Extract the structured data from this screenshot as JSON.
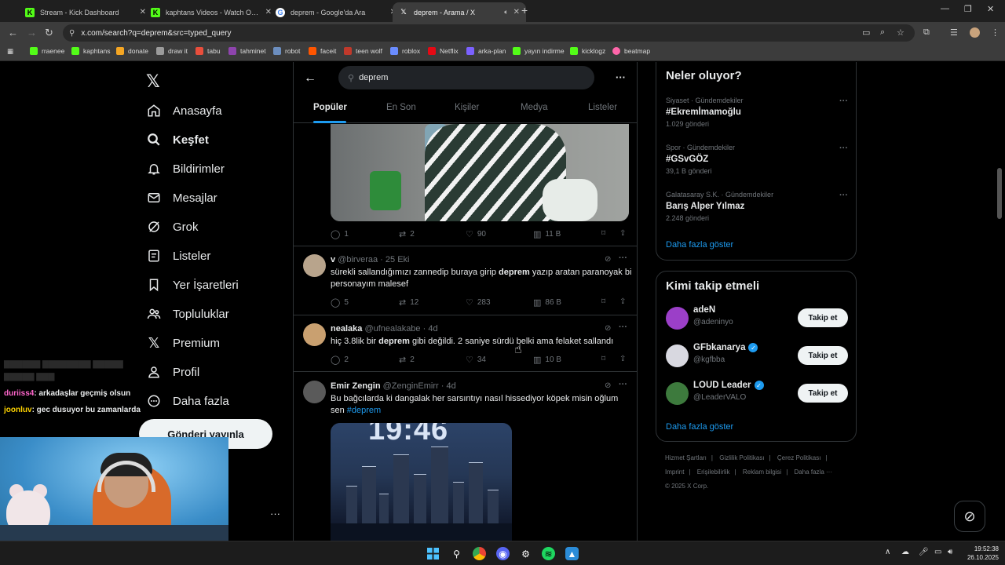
{
  "browser": {
    "tabs": [
      {
        "title": "Stream - Kick Dashboard",
        "icon": "kick-icon",
        "active": false
      },
      {
        "title": "kaphtans Videos - Watch On-D",
        "icon": "kick-icon",
        "active": false
      },
      {
        "title": "deprem - Google'da Ara",
        "icon": "google-icon",
        "active": false
      },
      {
        "title": "deprem - Arama / X",
        "icon": "x-icon",
        "active": true
      }
    ],
    "url": "x.com/search?q=deprem&src=typed_query",
    "bookmarks": [
      {
        "label": "rraenee",
        "color": "#53fc18"
      },
      {
        "label": "kaphtans",
        "color": "#53fc18"
      },
      {
        "label": "donate",
        "color": "#f5a623"
      },
      {
        "label": "draw it",
        "color": "#9b9b9b"
      },
      {
        "label": "tabu",
        "color": "#e94e3c"
      },
      {
        "label": "tahminet",
        "color": "#8e44ad"
      },
      {
        "label": "robot",
        "color": "#6c8ebf"
      },
      {
        "label": "faceit",
        "color": "#ff5500"
      },
      {
        "label": "teen wolf",
        "color": "#c0392b"
      },
      {
        "label": "roblox",
        "color": "#6a8cff"
      },
      {
        "label": "Netflix",
        "color": "#e50914"
      },
      {
        "label": "arka-plan",
        "color": "#7b61ff"
      },
      {
        "label": "yayın indirme",
        "color": "#53fc18"
      },
      {
        "label": "kicklogz",
        "color": "#53fc18"
      },
      {
        "label": "beatmap",
        "color": "#ff66aa"
      }
    ]
  },
  "nav": {
    "logo": "𝕏",
    "items": [
      {
        "label": "Anasayfa",
        "icon": "home-icon"
      },
      {
        "label": "Keşfet",
        "icon": "search-icon"
      },
      {
        "label": "Bildirimler",
        "icon": "bell-icon"
      },
      {
        "label": "Mesajlar",
        "icon": "mail-icon"
      },
      {
        "label": "Grok",
        "icon": "grok-icon"
      },
      {
        "label": "Listeler",
        "icon": "list-icon"
      },
      {
        "label": "Yer İşaretleri",
        "icon": "bookmark-icon"
      },
      {
        "label": "Topluluklar",
        "icon": "people-icon"
      },
      {
        "label": "Premium",
        "icon": "x-premium-icon"
      },
      {
        "label": "Profil",
        "icon": "profile-icon"
      },
      {
        "label": "Daha fazla",
        "icon": "more-icon"
      }
    ],
    "post_button": "Gönderi yayınla"
  },
  "chat": {
    "lines": [
      {
        "user": "duriiss4",
        "text": ": arkadaşlar geçmiş olsun"
      },
      {
        "user": "joonluv",
        "text": ": gec dusuyor bu zamanlarda"
      }
    ]
  },
  "search": {
    "query": "deprem",
    "tabs": [
      "Popüler",
      "En Son",
      "Kişiler",
      "Medya",
      "Listeler"
    ],
    "active_tab": "Popüler"
  },
  "top_tweet_actions": {
    "reply": "1",
    "retweet": "2",
    "like": "90",
    "views": "11 B"
  },
  "tweets": [
    {
      "name": "v",
      "handle": "@birveraa",
      "date": "25 Eki",
      "text_pre": "sürekli sallandığımızı zannedip buraya girip ",
      "text_bold": "deprem",
      "text_post": " yazıp aratan paranoyak bi personayım malesef",
      "reply": "5",
      "retweet": "12",
      "like": "283",
      "views": "86 B",
      "avatar_color": "#b8a48c"
    },
    {
      "name": "nealaka",
      "handle": "@ufnealakabe",
      "date": "4d",
      "text_pre": "hiç 3.8lik bir ",
      "text_bold": "deprem",
      "text_post": " gibi değildi. 2 saniye sürdü belki ama felaket sallandı",
      "reply": "2",
      "retweet": "2",
      "like": "34",
      "views": "10 B",
      "avatar_color": "#c9a070"
    },
    {
      "name": "Emir Zengin",
      "handle": "@ZenginEmirr",
      "date": "4d",
      "text_pre": "Bu bağcılarda ki dangalak her sarsıntıyı nasıl hissediyor köpek misin oğlum sen ",
      "hashtag": "#deprem",
      "avatar_color": "#5a5a5a",
      "image_time": "19:46"
    }
  ],
  "trends": {
    "title": "Neler oluyor?",
    "items": [
      {
        "meta": "Siyaset · Gündemdekiler",
        "name": "#Ekremİmamoğlu",
        "count": "1.029 gönderi"
      },
      {
        "meta": "Spor · Gündemdekiler",
        "name": "#GSvGÖZ",
        "count": "39,1 B gönderi"
      },
      {
        "meta": "Galatasaray S.K. · Gündemdekiler",
        "name": "Barış Alper Yılmaz",
        "count": "2.248 gönderi"
      }
    ],
    "show_more": "Daha fazla göster"
  },
  "who_to_follow": {
    "title": "Kimi takip etmeli",
    "items": [
      {
        "name": "adeN",
        "handle": "@adeninyo",
        "verified": false,
        "button": "Takip et",
        "avatar_color": "#9b3fc8"
      },
      {
        "name": "GFbkanarya",
        "handle": "@kgfbba",
        "verified": true,
        "button": "Takip et",
        "avatar_color": "#d8d8e0"
      },
      {
        "name": "LOUD Leader",
        "handle": "@LeaderVALO",
        "verified": true,
        "button": "Takip et",
        "avatar_color": "#3d7a3d"
      }
    ],
    "show_more": "Daha fazla göster"
  },
  "footer": {
    "links": [
      "Hizmet Şartları",
      "|",
      "Gizlilik Politikası",
      "|",
      "Çerez Politikası",
      "|",
      "Imprint",
      "|",
      "Erişilebilirlik",
      "|",
      "Reklam bilgisi",
      "|",
      "Daha fazla ···"
    ],
    "copyright": "© 2025 X Corp."
  },
  "taskbar": {
    "time": "19:52:38",
    "date": "26.10.2025"
  }
}
